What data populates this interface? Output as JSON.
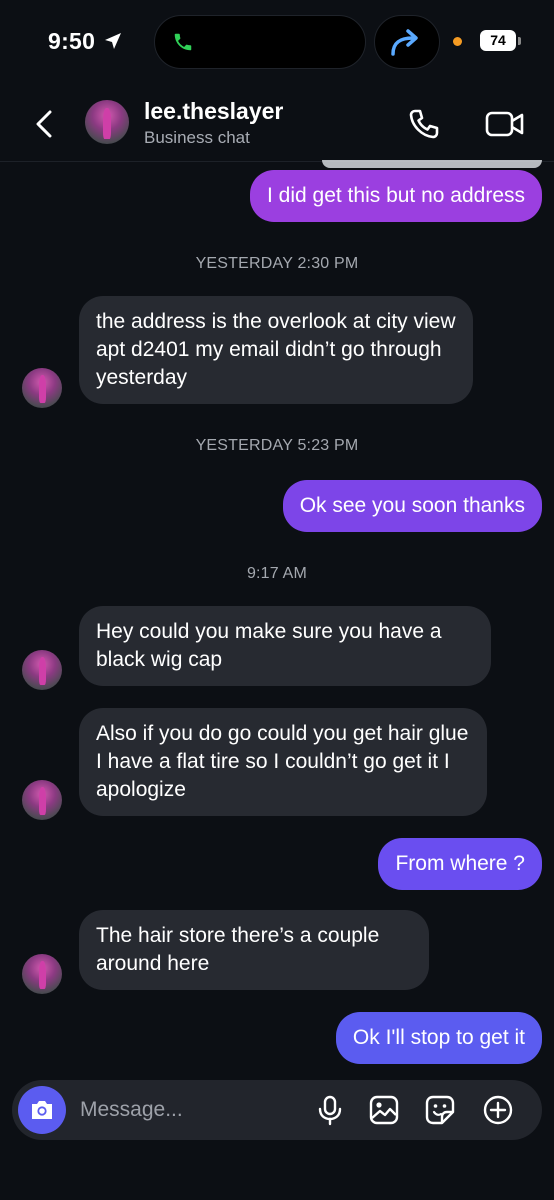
{
  "status_bar": {
    "time": "9:50",
    "battery": "74"
  },
  "header": {
    "name": "lee.theslayer",
    "subtitle": "Business chat"
  },
  "messages": [
    {
      "type": "outgoing",
      "text": "I did get this but no address"
    },
    {
      "type": "timestamp",
      "text": "YESTERDAY 2:30 PM"
    },
    {
      "type": "incoming",
      "text": "the address is the overlook at city view  apt d2401 my email didn’t go through yesterday"
    },
    {
      "type": "timestamp",
      "text": "YESTERDAY 5:23 PM"
    },
    {
      "type": "outgoing",
      "text": "Ok see you soon thanks"
    },
    {
      "type": "timestamp",
      "text": "9:17 AM"
    },
    {
      "type": "incoming",
      "text": "Hey could you make sure you have a black wig cap"
    },
    {
      "type": "incoming",
      "text": "Also if you do go could you get hair glue I have a flat tire so I couldn’t go get it I apologize"
    },
    {
      "type": "outgoing",
      "text": "From where ?"
    },
    {
      "type": "incoming",
      "text": "The hair store there’s a couple around here"
    },
    {
      "type": "outgoing",
      "text": "Ok I'll stop to get it"
    }
  ],
  "composer": {
    "placeholder": "Message..."
  },
  "colors": {
    "outgoing_top": "#9b3fe0",
    "outgoing_bottom": "#5b5cf0",
    "incoming": "#272a31",
    "background": "#0c0f14"
  },
  "icons": [
    "location-arrow-icon",
    "phone-icon",
    "share-icon",
    "chevron-left-icon",
    "phone-icon",
    "video-icon",
    "camera-icon",
    "microphone-icon",
    "gallery-icon",
    "sticker-icon",
    "plus-icon"
  ]
}
